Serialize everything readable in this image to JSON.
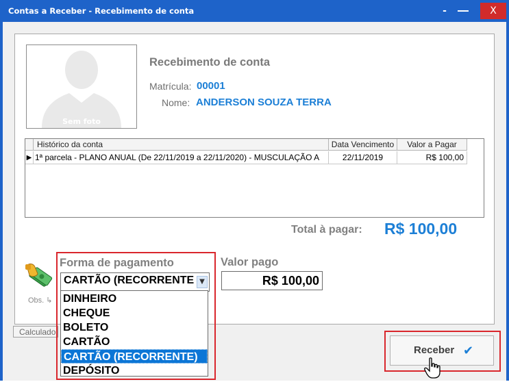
{
  "window": {
    "title": "Contas a Receber - Recebimento de conta",
    "minimize_label": "-",
    "close_label": "X"
  },
  "photo": {
    "caption": "Sem foto"
  },
  "header": {
    "heading": "Recebimento de conta",
    "matricula_label": "Matrícula:",
    "matricula_value": "00001",
    "nome_label": "Nome:",
    "nome_value": "ANDERSON SOUZA TERRA"
  },
  "grid": {
    "columns": [
      "Histórico da conta",
      "Data Vencimento",
      "Valor a Pagar"
    ],
    "rows": [
      [
        "1ª parcela - PLANO ANUAL (De 22/11/2019 a 22/11/2020) - MUSCULAÇÃO A",
        "22/11/2019",
        "R$ 100,00"
      ]
    ],
    "row_marker": "▶"
  },
  "total": {
    "label": "Total à pagar:",
    "value": "R$ 100,00"
  },
  "payment": {
    "label": "Forma de pagamento",
    "selected": "CARTÃO (RECORRENTE",
    "options": [
      "DINHEIRO",
      "CHEQUE",
      "BOLETO",
      "CARTÃO",
      "CARTÃO (RECORRENTE)",
      "DEPÓSITO"
    ],
    "selected_index": 4
  },
  "valor_pago": {
    "label": "Valor pago",
    "value": "R$ 100,00"
  },
  "obs": {
    "label": "Obs."
  },
  "calc_button": {
    "label": "Calculado a"
  },
  "receber_button": {
    "label": "Receber",
    "check": "✔"
  },
  "colors": {
    "accent": "#1c7fd6",
    "titlebar": "#1e63c9",
    "highlight": "#d9262c",
    "selection": "#0c76d6"
  }
}
